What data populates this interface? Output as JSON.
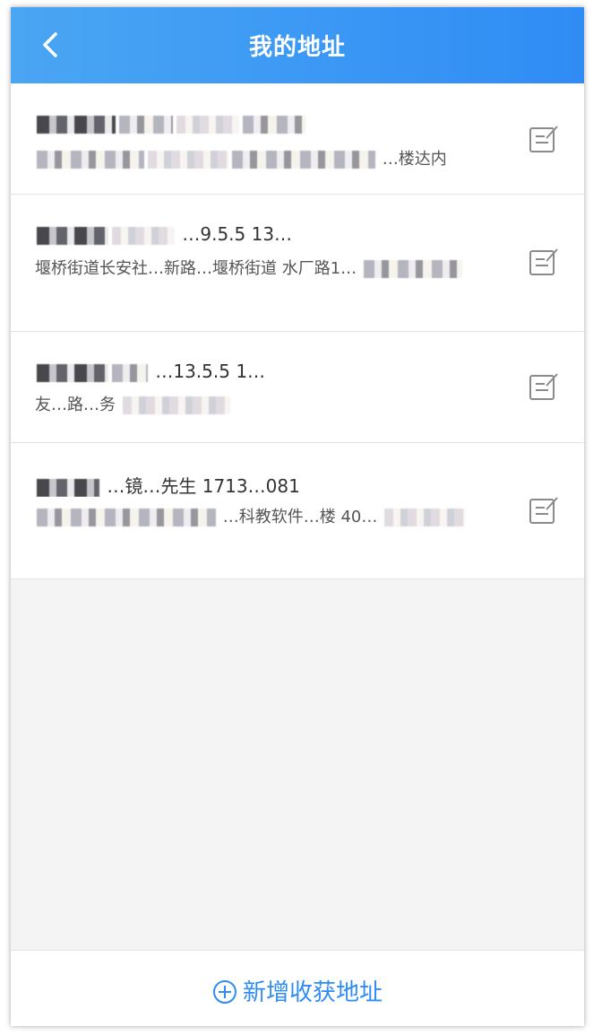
{
  "header": {
    "title": "我的地址",
    "back_icon": "chevron-left-icon"
  },
  "addresses": [
    {
      "line1_visible": "",
      "line2_visible": "…楼达内"
    },
    {
      "line1_visible": "…9.5.5 13…",
      "line2_visible": "堰桥街道长安社…新路…堰桥街道 水厂路1…"
    },
    {
      "line1_visible": "…13.5.5 1…",
      "line2_visible": "友…路…务"
    },
    {
      "line1_visible": "…镜…先生 1713…081",
      "line2_visible": "…科教软件…楼 40…"
    }
  ],
  "edit_icon": "edit-note-icon",
  "footer": {
    "add_label": "新增收获地址",
    "add_icon": "plus-circle-icon"
  },
  "colors": {
    "header_start": "#4aa6f3",
    "header_end": "#2f8cf4",
    "accent": "#2f8cf4",
    "background": "#f4f4f4"
  }
}
